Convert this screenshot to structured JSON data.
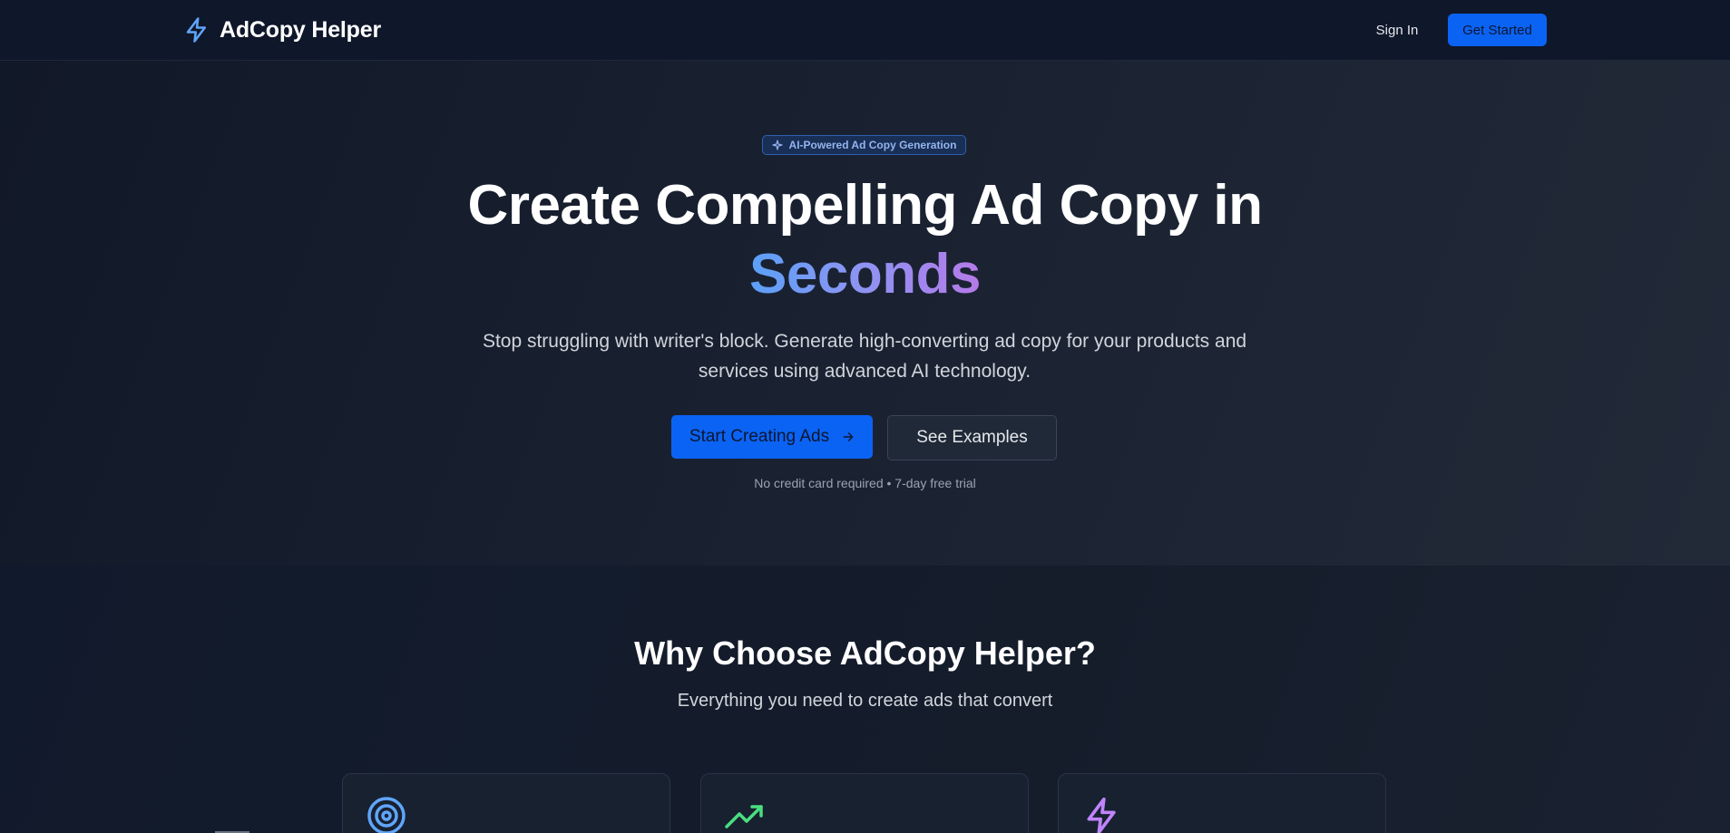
{
  "navbar": {
    "brand_name": "AdCopy Helper",
    "brand_icon": "lightning-icon",
    "sign_in_label": "Sign In",
    "get_started_label": "Get Started"
  },
  "hero": {
    "badge_icon": "sparkle-icon",
    "badge_text": "AI-Powered Ad Copy Generation",
    "title_line1": "Create Compelling Ad Copy in",
    "title_accent": "Seconds",
    "subtitle_line1": "Stop struggling with writer's block. Generate high-converting ad copy for your products and",
    "subtitle_line2": "services using advanced AI technology.",
    "primary_button_label": "Start Creating Ads",
    "primary_button_icon": "arrow-right-icon",
    "secondary_button_label": "See Examples",
    "note": "No credit card required • 7-day free trial"
  },
  "features": {
    "title": "Why Choose AdCopy Helper?",
    "subtitle": "Everything you need to create ads that convert",
    "cards": [
      {
        "icon": "target-icon",
        "color": "#60a5fa"
      },
      {
        "icon": "trending-up-icon",
        "color": "#4ade80"
      },
      {
        "icon": "lightning-icon",
        "color": "#c084fc"
      }
    ]
  },
  "colors": {
    "accent_blue": "#0b63f3",
    "background": "#111827",
    "brand_icon": "#60a5fa"
  }
}
